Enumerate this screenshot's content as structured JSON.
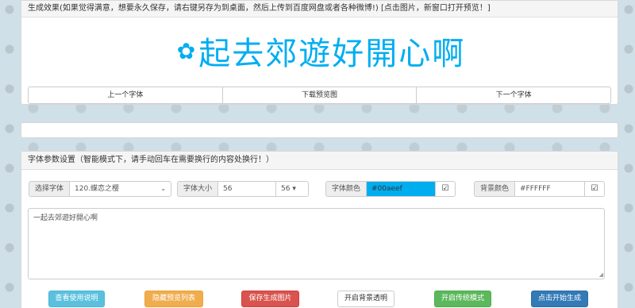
{
  "preview": {
    "header": "生成效果(如果觉得满意，想要永久保存，请右键另存为到桌面，然后上传到百度网盘或者各种微博!) [点击图片，新窗口打开预览！]",
    "text": "起去郊遊好開心啊",
    "prev_font": "上一个字体",
    "download": "下载预览图",
    "next_font": "下一个字体"
  },
  "settings": {
    "header": "字体参数设置（智能模式下，请手动回车在需要换行的内容处换行！）",
    "font_label": "选择字体",
    "font_value": "120.蝶恋之樱",
    "size_label": "字体大小",
    "size_value": "56",
    "size_select": "56",
    "color_label": "字体颜色",
    "color_value": "#00aeef",
    "bg_label": "背景颜色",
    "bg_value": "#FFFFFF",
    "content": "一起去郊遊好開心啊"
  },
  "buttons": {
    "help": "查看使用说明",
    "hide_list": "隐藏预览列表",
    "save_image": "保存生成图片",
    "transparent_bg": "开启背景透明",
    "classic_mode": "开启传统模式",
    "generate": "点击开始生成"
  },
  "colors": {
    "accent": "#00aeef",
    "info": "#5bc0de",
    "warning": "#f0ad4e",
    "danger": "#d9534f",
    "success": "#5cb85c",
    "primary": "#337ab7"
  },
  "icons": {
    "flower": "flower-icon",
    "check": "check-square-icon",
    "caret": "caret-down-icon"
  }
}
